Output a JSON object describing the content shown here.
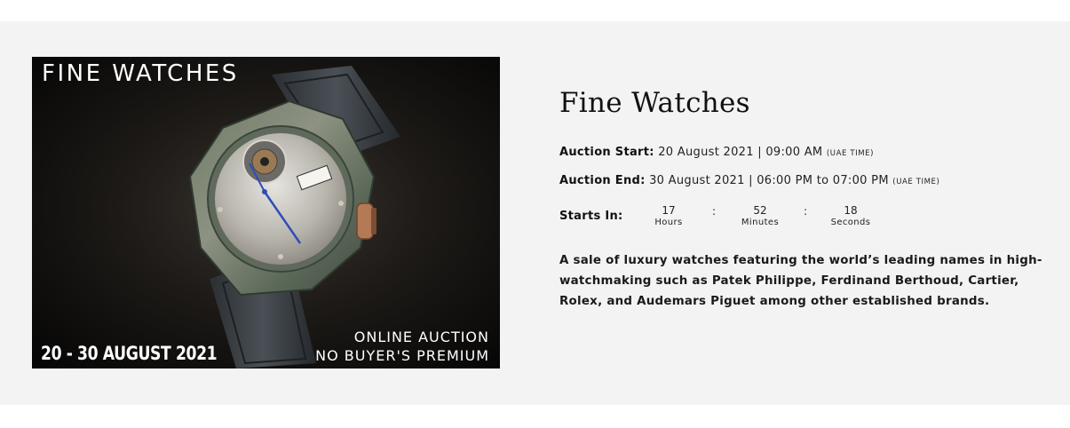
{
  "banner": {
    "heading": "FINE WATCHES",
    "dates": "20 - 30 AUGUST 2021",
    "online": "ONLINE AUCTION",
    "premium": "NO BUYER'S PREMIUM",
    "image_subject": "watch-image"
  },
  "auction": {
    "title": "Fine Watches",
    "start_label": "Auction Start:",
    "start_value": "20 August 2021 | 09:00 AM",
    "start_tz": "(UAE TIME)",
    "end_label": "Auction End:",
    "end_value": "30 August 2021 | 06:00 PM to 07:00 PM",
    "end_tz": "(UAE TIME)",
    "starts_in_label": "Starts In:",
    "countdown": {
      "hours": "17",
      "hours_label": "Hours",
      "minutes": "52",
      "minutes_label": "Minutes",
      "seconds": "18",
      "seconds_label": "Seconds",
      "separator": ":"
    },
    "description": "A sale of luxury watches featuring the world’s leading names in high-watchmaking such as Patek Philippe, Ferdinand Berthoud, Cartier, Rolex, and Audemars Piguet among other established brands."
  },
  "colors": {
    "band_background": "#f3f3f3",
    "page_background": "#ffffff",
    "text": "#111111"
  }
}
